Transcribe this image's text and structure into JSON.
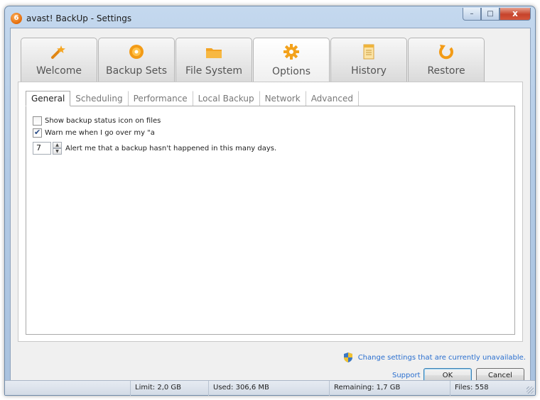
{
  "window": {
    "title": "avast! BackUp - Settings",
    "app_icon_glyph": "6",
    "minimize_glyph": "–",
    "maximize_glyph": "□",
    "close_glyph": "x"
  },
  "main_tabs": [
    {
      "label": "Welcome",
      "icon": "magic-wand-icon",
      "active": false
    },
    {
      "label": "Backup Sets",
      "icon": "disc-icon",
      "active": false
    },
    {
      "label": "File System",
      "icon": "folder-icon",
      "active": false
    },
    {
      "label": "Options",
      "icon": "gear-icon",
      "active": true
    },
    {
      "label": "History",
      "icon": "notepad-icon",
      "active": false
    },
    {
      "label": "Restore",
      "icon": "restore-arrow-icon",
      "active": false
    }
  ],
  "sub_tabs": [
    {
      "label": "General",
      "active": true
    },
    {
      "label": "Scheduling",
      "active": false
    },
    {
      "label": "Performance",
      "active": false
    },
    {
      "label": "Local Backup",
      "active": false
    },
    {
      "label": "Network",
      "active": false
    },
    {
      "label": "Advanced",
      "active": false
    }
  ],
  "general": {
    "show_status_icon_label": "Show backup status icon on files",
    "show_status_icon_checked": false,
    "warn_quota_label": "Warn me when I go over my \"a",
    "warn_quota_checked": true,
    "alert_days_value": "7",
    "alert_days_label": "Alert me that a backup hasn't happened in this many days."
  },
  "footer": {
    "unavailable_notice": "Change settings that are currently unavailable.",
    "support_label": "Support",
    "ok_label": "OK",
    "cancel_label": "Cancel"
  },
  "status": {
    "limit": "Limit: 2,0 GB",
    "used": "Used: 306,6 MB",
    "remaining": "Remaining: 1,7 GB",
    "files": "Files: 558"
  },
  "colors": {
    "accent_orange": "#f29a1d",
    "link_blue": "#2a6fcf"
  }
}
